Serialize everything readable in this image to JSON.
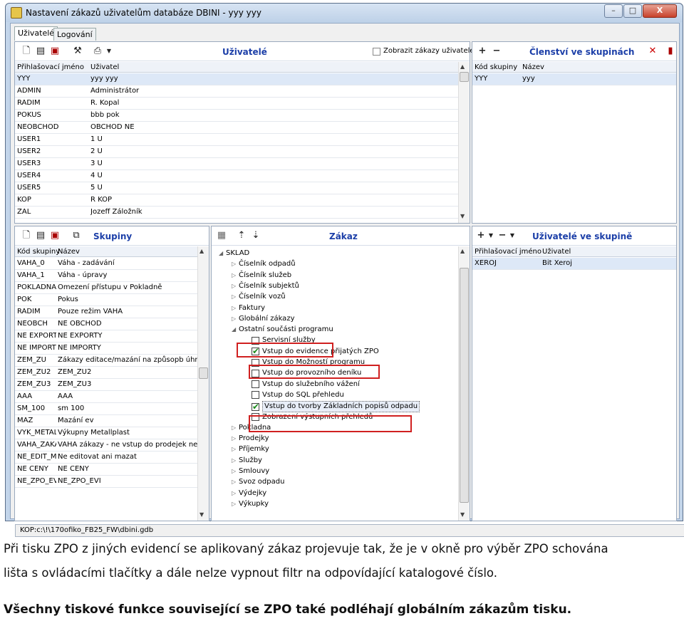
{
  "window": {
    "title": "Nastavení zákazů uživatelům databáze DBINI - yyy yyy",
    "minimize": "–",
    "maximize": "□",
    "close": "X"
  },
  "tabs": [
    {
      "label": "Uživatelé"
    },
    {
      "label": "Logování"
    }
  ],
  "users_panel": {
    "title": "Uživatelé",
    "checkbox_label": "Zobrazit zákazy uživatele",
    "columns": [
      "Přihlašovací jméno",
      "Uživatel"
    ],
    "rows": [
      [
        "YYY",
        "yyy yyy"
      ],
      [
        "ADMIN",
        "Administrátor"
      ],
      [
        "RADIM",
        "R. Kopal"
      ],
      [
        "POKUS",
        "bbb pok"
      ],
      [
        "NEOBCHOD",
        "OBCHOD NE"
      ],
      [
        "USER1",
        "1 U"
      ],
      [
        "USER2",
        "2 U"
      ],
      [
        "USER3",
        "3 U"
      ],
      [
        "USER4",
        "4 U"
      ],
      [
        "USER5",
        "5 U"
      ],
      [
        "KOP",
        "R KOP"
      ],
      [
        "ZAL",
        "Jozeff Záložník"
      ]
    ]
  },
  "membership_panel": {
    "title": "Členství ve skupinách",
    "add": "+",
    "remove": "−",
    "close": "✕",
    "columns": [
      "Kód skupiny",
      "Název"
    ],
    "rows": [
      [
        "YYY",
        "yyy"
      ]
    ]
  },
  "groups_panel": {
    "title": "Skupiny",
    "columns": [
      "Kód skupiny",
      "Název"
    ],
    "rows": [
      [
        "VAHA_0",
        "Váha - zadávání"
      ],
      [
        "VAHA_1",
        "Váha - úpravy"
      ],
      [
        "POKLADNA",
        "Omezení přístupu v Pokladně"
      ],
      [
        "POK",
        "Pokus"
      ],
      [
        "RADIM",
        "Pouze režim VAHA"
      ],
      [
        "NEOBCH",
        "NE OBCHOD"
      ],
      [
        "NE EXPORTY",
        "NE EXPORTY"
      ],
      [
        "NE IMPORTY",
        "NE IMPORTY"
      ],
      [
        "ZEM_ZU",
        "Zákazy editace/mazání na způsopb úhrad"
      ],
      [
        "ZEM_ZU2",
        "ZEM_ZU2"
      ],
      [
        "ZEM_ZU3",
        "ZEM_ZU3"
      ],
      [
        "AAA",
        "AAA"
      ],
      [
        "SM_100",
        "sm 100"
      ],
      [
        "MAZ",
        "Mazání ev"
      ],
      [
        "VYK_METALL",
        "Výkupny Metallplast"
      ],
      [
        "VAHA_ZAKAZ",
        "VAHA zákazy - ne vstup do prodejek ne p"
      ],
      [
        "NE_EDIT_MAZ",
        "Ne editovat ani mazat"
      ],
      [
        "NE CENY",
        "NE CENY"
      ],
      [
        "NE_ZPO_EVI",
        "NE_ZPO_EVI"
      ]
    ]
  },
  "tree_panel": {
    "title": "Zákaz",
    "nodes": [
      {
        "label": "SKLAD",
        "level": 0,
        "exp": "◢"
      },
      {
        "label": "Číselník odpadů",
        "level": 1,
        "exp": "▷"
      },
      {
        "label": "Číselník služeb",
        "level": 1,
        "exp": "▷"
      },
      {
        "label": "Číselník subjektů",
        "level": 1,
        "exp": "▷"
      },
      {
        "label": "Číselník vozů",
        "level": 1,
        "exp": "▷"
      },
      {
        "label": "Faktury",
        "level": 1,
        "exp": "▷"
      },
      {
        "label": "Globální zákazy",
        "level": 1,
        "exp": "▷"
      },
      {
        "label": "Ostatní součásti programu",
        "level": 1,
        "exp": "◢"
      },
      {
        "label": "Servisní služby",
        "level": 2,
        "check": ""
      },
      {
        "label": "Vstup do evidence přijatých ZPO",
        "level": 2,
        "check": "✔"
      },
      {
        "label": "Vstup do Možností programu",
        "level": 2,
        "check": ""
      },
      {
        "label": "Vstup do provozního deníku",
        "level": 2,
        "check": ""
      },
      {
        "label": "Vstup do služebního vážení",
        "level": 2,
        "check": ""
      },
      {
        "label": "Vstup do SQL přehledu",
        "level": 2,
        "check": ""
      },
      {
        "label": "Vstup do tvorby Základních popisů odpadu",
        "level": 2,
        "check": "✔",
        "hl": true
      },
      {
        "label": "Zobrazení výstupních přehledů",
        "level": 2,
        "check": ""
      },
      {
        "label": "Pokladna",
        "level": 1,
        "exp": "▷"
      },
      {
        "label": "Prodejky",
        "level": 1,
        "exp": "▷"
      },
      {
        "label": "Příjemky",
        "level": 1,
        "exp": "▷"
      },
      {
        "label": "Služby",
        "level": 1,
        "exp": "▷"
      },
      {
        "label": "Smlouvy",
        "level": 1,
        "exp": "▷"
      },
      {
        "label": "Svoz odpadu",
        "level": 1,
        "exp": "▷"
      },
      {
        "label": "Výdejky",
        "level": 1,
        "exp": "▷"
      },
      {
        "label": "Výkupky",
        "level": 1,
        "exp": "▷"
      }
    ]
  },
  "group_users_panel": {
    "title": "Uživatelé ve skupině",
    "columns": [
      "Přihlašovací jméno",
      "Uživatel"
    ],
    "rows": [
      [
        "XEROJ",
        "Bit Xeroj"
      ]
    ]
  },
  "status": "KOP:c:\\!\\170ofiko_FB25_FW\\dbini.gdb",
  "caption": {
    "line1": "Při tisku ZPO z jiných evidencí se aplikovaný zákaz projevuje tak, že je v okně pro výběr ZPO schována",
    "line2": "lišta s ovládacími tlačítky a dále nelze vypnout filtr na odpovídající katalogové číslo.",
    "line3": "Všechny tiskové funkce související se ZPO také podléhají globálním zákazům tisku."
  }
}
